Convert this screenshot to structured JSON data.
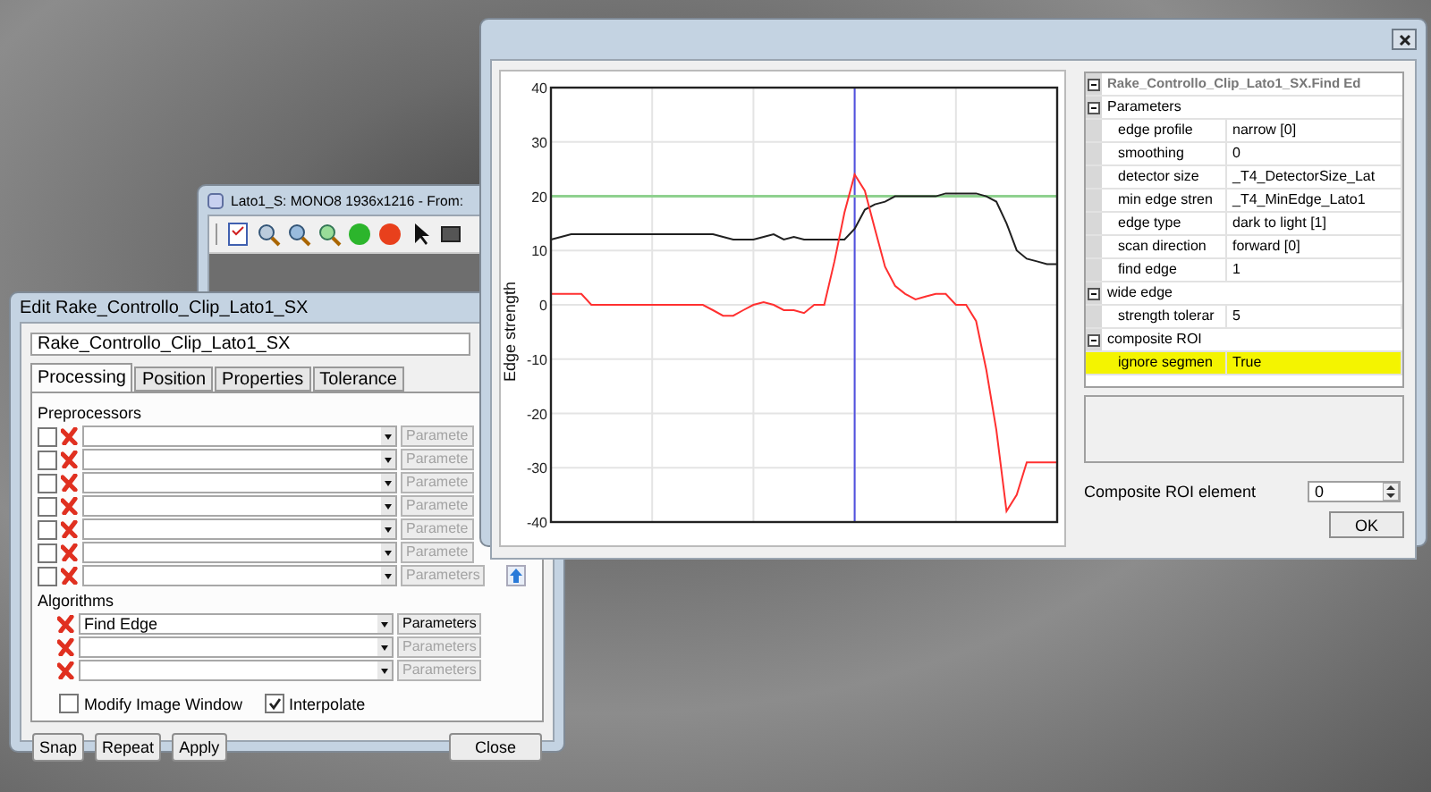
{
  "image_window": {
    "title": "Lato1_S: MONO8 1936x1216 - From:"
  },
  "edit_window": {
    "title": "Edit Rake_Controllo_Clip_Lato1_SX",
    "name": "Rake_Controllo_Clip_Lato1_SX",
    "tabs": [
      {
        "label": "Processing",
        "selected": true
      },
      {
        "label": "Position",
        "selected": false
      },
      {
        "label": "Properties",
        "selected": false
      },
      {
        "label": "Tolerance",
        "selected": false
      }
    ],
    "preprocessors": {
      "label": "Preprocessors",
      "rows": [
        {
          "checked": false,
          "button": "Paramete",
          "enabled": false
        },
        {
          "checked": false,
          "button": "Paramete",
          "enabled": false
        },
        {
          "checked": false,
          "button": "Paramete",
          "enabled": false
        },
        {
          "checked": false,
          "button": "Paramete",
          "enabled": false
        },
        {
          "checked": false,
          "button": "Paramete",
          "enabled": false
        },
        {
          "checked": false,
          "button": "Paramete",
          "enabled": false
        },
        {
          "checked": false,
          "button": "Parameters",
          "enabled": false
        }
      ]
    },
    "algorithms": {
      "label": "Algorithms",
      "rows": [
        {
          "value": "Find Edge",
          "button": "Parameters",
          "enabled": true
        },
        {
          "button": "Parameters",
          "enabled": false
        },
        {
          "button": "Parameters",
          "enabled": false
        }
      ]
    },
    "options": [
      {
        "label": "Modify Image Window",
        "checked": false
      },
      {
        "label": "Interpolate",
        "checked": true
      }
    ],
    "buttons": [
      "Snap",
      "Repeat",
      "Apply",
      "Close"
    ]
  },
  "chart_window": {
    "chart_data": {
      "type": "line",
      "ylabel": "Edge strength",
      "ylim": [
        -40,
        40
      ],
      "yticks": [
        -40,
        -30,
        -20,
        -10,
        0,
        10,
        20,
        30,
        40
      ],
      "categories": [
        null,
        null,
        null,
        null,
        null,
        null,
        null,
        null,
        null,
        null,
        null,
        null,
        null,
        null,
        null,
        null,
        null,
        null,
        null,
        null,
        null,
        null,
        null,
        null,
        null,
        null,
        null,
        null,
        null,
        null,
        null,
        null,
        null,
        null,
        null,
        null,
        null,
        null,
        null,
        null,
        null,
        null,
        null,
        null,
        null,
        null,
        null,
        null,
        null,
        null,
        null
      ],
      "series": [
        {
          "color": "#202020",
          "values": [
            12,
            12.5,
            13,
            13,
            13,
            13,
            13,
            13,
            13,
            13,
            13,
            13,
            13,
            13,
            13,
            13,
            13,
            12.5,
            12,
            12,
            12,
            12.5,
            13,
            12,
            12.5,
            12,
            12,
            12,
            12,
            12,
            14,
            17.5,
            18.5,
            19,
            20,
            20,
            20,
            20,
            20,
            20.5,
            20.5,
            20.5,
            20.5,
            20,
            19,
            15,
            10,
            8.5,
            8,
            7.5,
            7.5
          ]
        },
        {
          "color": "#ff3030",
          "values": [
            2,
            2,
            2,
            2,
            0,
            0,
            0,
            0,
            0,
            0,
            0,
            0,
            0,
            0,
            0,
            0,
            -1,
            -2,
            -2,
            -1,
            0,
            0.5,
            0,
            -1,
            -1,
            -1.5,
            0,
            0,
            8,
            17,
            24,
            21,
            14,
            7,
            3.5,
            2,
            1,
            1.5,
            2,
            2,
            0,
            0,
            -3,
            -12,
            -23,
            -38,
            -35,
            -29,
            -29,
            -29,
            -29
          ]
        }
      ],
      "grid": true,
      "ref_lines": [
        {
          "axis": "y",
          "value": 20
        }
      ]
    },
    "property_grid": {
      "title": "Rake_Controllo_Clip_Lato1_SX.Find Ed",
      "categories": [
        {
          "label": "Parameters",
          "expanded": true,
          "children": [
            {
              "name": "edge profile",
              "value": "narrow [0]",
              "highlighted": false
            },
            {
              "name": "smoothing",
              "value": "0",
              "highlighted": false
            },
            {
              "name": "detector size",
              "value": "_T4_DetectorSize_Lat",
              "highlighted": false
            },
            {
              "name": "min edge stren",
              "value": "_T4_MinEdge_Lato1",
              "highlighted": false
            },
            {
              "name": "edge type",
              "value": "dark to light [1]",
              "highlighted": false
            },
            {
              "name": "scan direction",
              "value": "forward [0]",
              "highlighted": false
            },
            {
              "name": "find edge",
              "value": "1",
              "highlighted": false
            }
          ]
        },
        {
          "label": "wide edge",
          "expanded": true,
          "children": [
            {
              "name": "strength tolerar",
              "value": "5",
              "highlighted": false
            }
          ]
        },
        {
          "label": "composite ROI",
          "expanded": true,
          "children": [
            {
              "name": "ignore segmen",
              "value": "True",
              "highlighted": true
            }
          ]
        }
      ]
    },
    "composite_roi_element": {
      "label": "Composite ROI element",
      "value": "0"
    },
    "ok_button": "OK"
  }
}
